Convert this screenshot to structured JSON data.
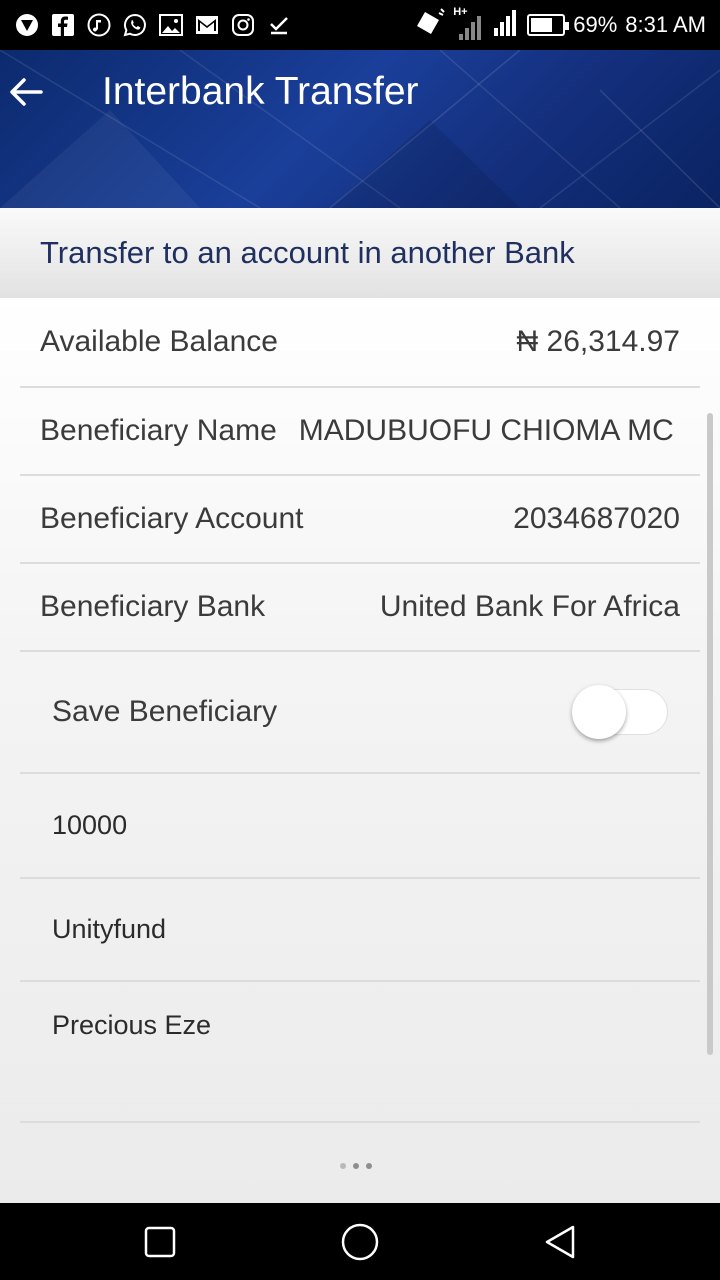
{
  "status_bar": {
    "left_icons": [
      "vpn-icon",
      "facebook-icon",
      "music-icon",
      "whatsapp-icon",
      "gallery-icon",
      "gmail-icon",
      "instagram-icon",
      "check-icon"
    ],
    "network": "H+",
    "battery": "69%",
    "battery_level": 0.69,
    "time": "8:31 AM"
  },
  "app_bar": {
    "title": "Interbank Transfer",
    "back_icon": "arrow-left-icon",
    "color": "#1a3f9a"
  },
  "subheader": {
    "text": "Transfer to an account in another Bank",
    "color": "#1f2f5f"
  },
  "details": {
    "balance_label": "Available Balance",
    "balance_value": "₦ 26,314.97",
    "name_label": "Beneficiary Name",
    "name_value": "MADUBUOFU CHIOMA MC",
    "account_label": "Beneficiary Account",
    "account_value": "2034687020",
    "bank_label": "Beneficiary Bank",
    "bank_value": "United Bank For Africa"
  },
  "save_beneficiary": {
    "label": "Save Beneficiary",
    "on": false
  },
  "inputs": {
    "amount": "10000",
    "narration": "Unityfund",
    "sender": "Precious Eze"
  },
  "nav_bar": {
    "icons": [
      "recent-apps-icon",
      "home-icon",
      "back-icon"
    ]
  }
}
